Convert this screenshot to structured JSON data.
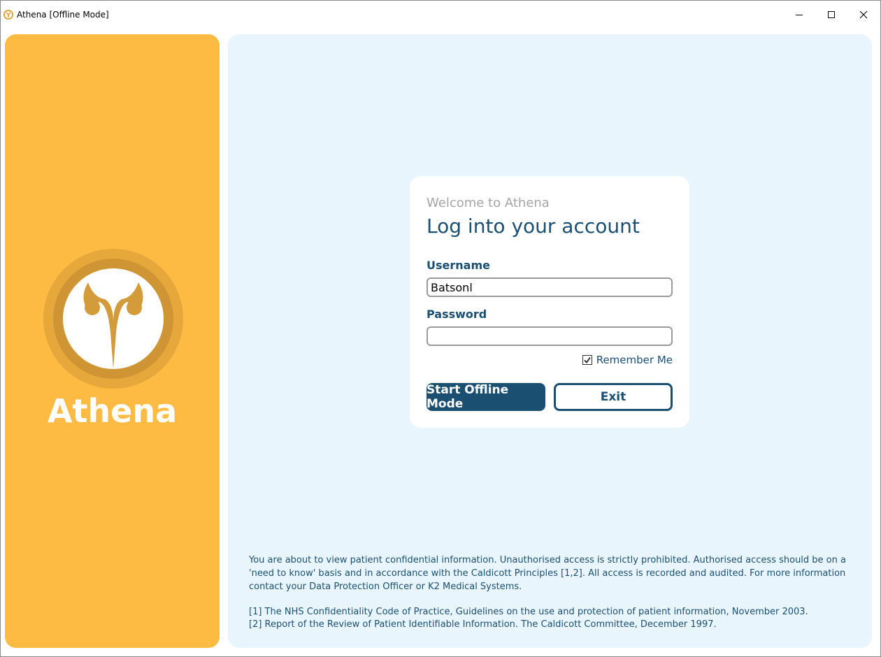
{
  "window": {
    "title": "Athena [Offline Mode]",
    "controls": {
      "minimize": "minimize",
      "maximize": "maximize",
      "close": "close"
    }
  },
  "sidebar": {
    "brand": "Athena",
    "background": "#fdbb43",
    "logo_icon": "athena-owl-logo"
  },
  "login": {
    "welcome": "Welcome to Athena",
    "heading": "Log into your account",
    "username_label": "Username",
    "username_value": "Batsonl",
    "password_label": "Password",
    "password_value": "",
    "remember_label": "Remember Me",
    "remember_checked": true,
    "primary_button": "Start Offline Mode",
    "secondary_button": "Exit"
  },
  "footer": {
    "disclaimer": "You are about to view patient confidential information. Unauthorised access is strictly prohibited. Authorised access should be on a 'need to know' basis and in accordance with the Caldicott Principles [1,2]. All access is recorded and audited. For more information contact your Data Protection Officer or K2 Medical Systems.",
    "references": [
      "[1] The NHS Confidentiality Code of Practice, Guidelines on the use and protection of patient information, November 2003.",
      "[2] Report of the Review of Patient Identifiable Information. The Caldicott Committee, December 1997."
    ]
  },
  "colors": {
    "accent": "#1b4f72",
    "main_background": "#e8f5fd",
    "muted_text": "#a5a5a5"
  }
}
